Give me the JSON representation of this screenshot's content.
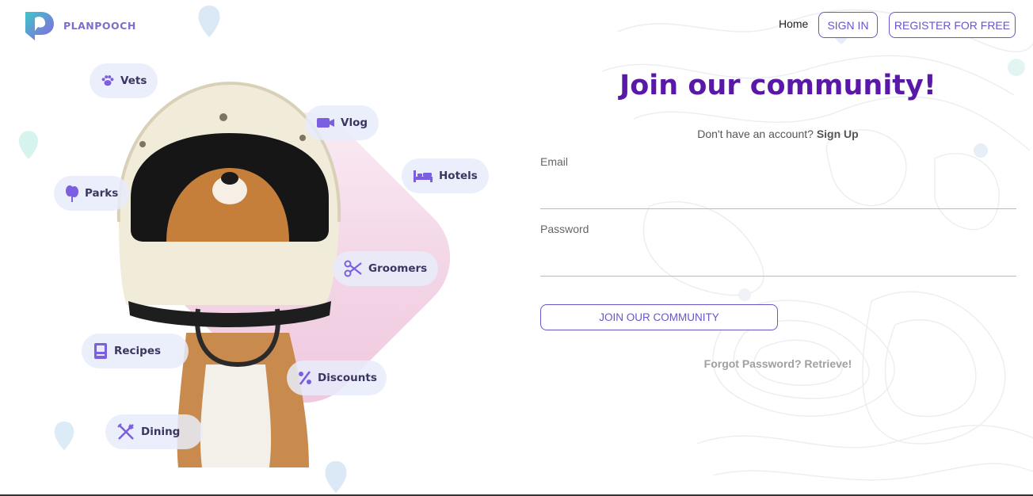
{
  "header": {
    "brand": "PLANPOOCH",
    "nav": {
      "home": "Home",
      "sign_in": "SIGN IN",
      "register": "REGISTER FOR FREE"
    }
  },
  "hero": {
    "chips": [
      {
        "label": "Vets",
        "icon": "paw-icon"
      },
      {
        "label": "Vlog",
        "icon": "video-camera-icon"
      },
      {
        "label": "Hotels",
        "icon": "bed-icon"
      },
      {
        "label": "Parks",
        "icon": "tree-icon"
      },
      {
        "label": "Groomers",
        "icon": "scissors-icon"
      },
      {
        "label": "Recipes",
        "icon": "recipe-book-icon"
      },
      {
        "label": "Discounts",
        "icon": "percent-icon"
      },
      {
        "label": "Dining",
        "icon": "fork-knife-icon"
      }
    ]
  },
  "form": {
    "title": "Join our community!",
    "subtitle_prefix": "Don't have an account?",
    "subtitle_link": "Sign Up",
    "email_label": "Email",
    "email_value": "",
    "password_label": "Password",
    "password_value": "",
    "submit_label": "JOIN OUR COMMUNITY",
    "forgot_label": "Forgot Password? Retrieve!"
  },
  "colors": {
    "accent": "#6a55c8",
    "title": "#5a18a8",
    "brand_teal": "#3ec6c9",
    "brand_purple": "#8a63e0"
  }
}
